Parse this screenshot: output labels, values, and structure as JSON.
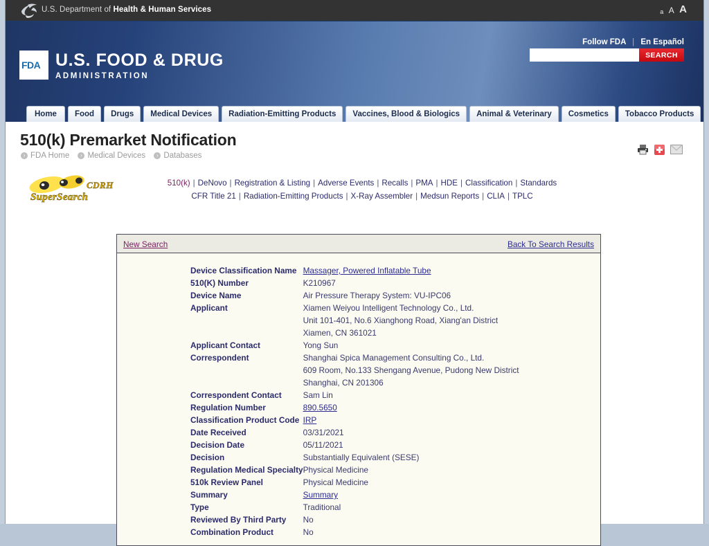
{
  "hhs": {
    "logo_icon": "hhs-eagle-icon",
    "text_prefix": "U.S. Department of ",
    "text_bold": "Health & Human Services",
    "font_small": "a",
    "font_medium": "A",
    "font_large": "A"
  },
  "banner": {
    "logo_mark": "FDA",
    "wordmark_line1": "U.S. FOOD & DRUG",
    "wordmark_line2": "ADMINISTRATION",
    "follow_fda": "Follow FDA",
    "separator": "|",
    "en_espanol": "En Español",
    "search_value": "",
    "search_placeholder": "",
    "search_button": "SEARCH",
    "search_icon": "search-icon",
    "accent_red": "#c5080f",
    "banner_blue": "#26427a"
  },
  "nav": {
    "tabs": [
      {
        "label": "Home"
      },
      {
        "label": "Food"
      },
      {
        "label": "Drugs"
      },
      {
        "label": "Medical Devices"
      },
      {
        "label": "Radiation-Emitting Products"
      },
      {
        "label": "Vaccines, Blood & Biologics"
      },
      {
        "label": "Animal & Veterinary"
      },
      {
        "label": "Cosmetics"
      },
      {
        "label": "Tobacco Products"
      }
    ]
  },
  "page": {
    "title": "510(k) Premarket Notification",
    "breadcrumbs": [
      "FDA Home",
      "Medical Devices",
      "Databases"
    ],
    "util_icons": [
      "print-icon",
      "share-plus-icon",
      "email-envelope-icon"
    ]
  },
  "supersearch": {
    "logo_icon": "binoculars-icon",
    "word_top": "CDRH",
    "word_bottom": "SuperSearch",
    "links_row1": [
      {
        "label": "510(k)",
        "visited": true
      },
      {
        "label": "DeNovo",
        "visited": false
      },
      {
        "label": "Registration & Listing",
        "visited": false
      },
      {
        "label": "Adverse Events",
        "visited": false
      },
      {
        "label": "Recalls",
        "visited": false
      },
      {
        "label": "PMA",
        "visited": false
      },
      {
        "label": "HDE",
        "visited": false
      },
      {
        "label": "Classification",
        "visited": false
      },
      {
        "label": "Standards",
        "visited": false
      }
    ],
    "links_row2": [
      {
        "label": "CFR Title 21",
        "visited": false
      },
      {
        "label": "Radiation-Emitting Products",
        "visited": false
      },
      {
        "label": "X-Ray Assembler",
        "visited": false
      },
      {
        "label": "Medsun Reports",
        "visited": false
      },
      {
        "label": "CLIA",
        "visited": false
      },
      {
        "label": "TPLC",
        "visited": false
      }
    ]
  },
  "panel": {
    "new_search": "New Search",
    "back_to_results": "Back To Search Results",
    "fields": [
      {
        "label": "Device Classification Name",
        "value": "Massager, Powered Inflatable Tube",
        "link": true
      },
      {
        "label": "510(K) Number",
        "value": "K210967",
        "link": false
      },
      {
        "label": "Device Name",
        "value": "Air Pressure Therapy System: VU-IPC06",
        "link": false
      },
      {
        "label": "Applicant",
        "value": "Xiamen Weiyou Intelligent Technology Co., Ltd.",
        "value2": "Unit 101-401, No.6 Xianghong Road, Xiang'an District",
        "value3": "Xiamen,  CN 361021",
        "link": false
      },
      {
        "label": "Applicant Contact",
        "value": "Yong Sun",
        "link": false
      },
      {
        "label": "Correspondent",
        "value": "Shanghai Spica Management Consulting Co., Ltd.",
        "value2": "609 Room, No.133 Shengang Avenue, Pudong New District",
        "value3": "Shanghai,  CN 201306",
        "link": false
      },
      {
        "label": "Correspondent Contact",
        "value": "Sam Lin",
        "link": false
      },
      {
        "label": "Regulation Number",
        "value": "890.5650",
        "link": true
      },
      {
        "label": "Classification Product Code",
        "value": "IRP",
        "link": true
      },
      {
        "label": "Date Received",
        "value": "03/31/2021",
        "link": false
      },
      {
        "label": "Decision Date",
        "value": "05/11/2021",
        "link": false
      },
      {
        "label": "Decision",
        "value": "Substantially Equivalent (SESE)",
        "link": false
      },
      {
        "label": "Regulation Medical Specialty",
        "value": "Physical Medicine",
        "link": false
      },
      {
        "label": "510k Review Panel",
        "value": "Physical Medicine",
        "link": false
      },
      {
        "label": "Summary",
        "value": "Summary",
        "link": true
      },
      {
        "label": "Type",
        "value": "Traditional",
        "link": false
      },
      {
        "label": "Reviewed By Third Party",
        "value": "No",
        "link": false
      },
      {
        "label": "Combination Product",
        "value": "No",
        "link": false
      }
    ]
  }
}
